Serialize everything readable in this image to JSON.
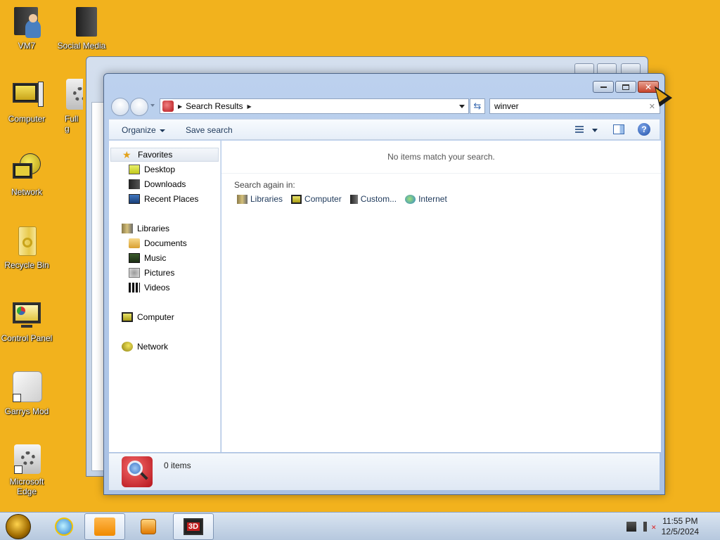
{
  "desktop": {
    "icons": [
      {
        "label": "VM7",
        "icon": "user-folder-icon"
      },
      {
        "label": "Social Media",
        "icon": "folder-icon"
      },
      {
        "label": "Computer",
        "icon": "computer-icon"
      },
      {
        "label": "Full g",
        "icon": "settings-shortcut-icon"
      },
      {
        "label": "Network",
        "icon": "network-icon"
      },
      {
        "label": "Recycle Bin",
        "icon": "recycle-bin-icon"
      },
      {
        "label": "Control Panel",
        "icon": "control-panel-icon"
      },
      {
        "label": "Garrys Mod",
        "icon": "app-shortcut-icon"
      },
      {
        "label": "Microsoft\nEdge",
        "icon": "gear-shortcut-icon"
      }
    ]
  },
  "explorer": {
    "address": {
      "crumb": "Search Results"
    },
    "search": {
      "value": "winver"
    },
    "toolbar": {
      "organize": "Organize",
      "save_search": "Save search"
    },
    "nav": {
      "favorites": "Favorites",
      "desktop": "Desktop",
      "downloads": "Downloads",
      "recent_places": "Recent Places",
      "libraries": "Libraries",
      "documents": "Documents",
      "music": "Music",
      "pictures": "Pictures",
      "videos": "Videos",
      "computer": "Computer",
      "network": "Network"
    },
    "content": {
      "no_items": "No items match your search.",
      "search_again": "Search again in:",
      "locations": [
        "Libraries",
        "Computer",
        "Custom...",
        "Internet"
      ]
    },
    "details": {
      "count": "0 items"
    }
  },
  "taskbar": {
    "time": "11:55 PM",
    "date": "12/5/2024",
    "overlay_badge": "3D"
  },
  "colors": {
    "desktop_bg": "#f2b21d",
    "accent": "#3a6ab0",
    "close_button": "#c7432a"
  }
}
